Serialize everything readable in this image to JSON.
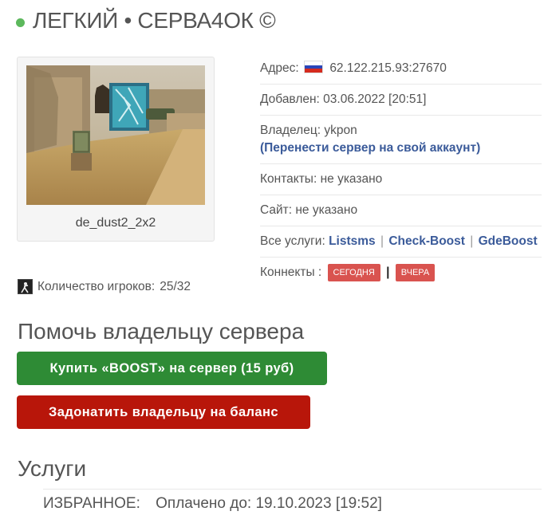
{
  "server": {
    "name": "ЛЕГКИЙ • СЕРВА4ОК ©",
    "map_name": "de_dust2_2x2",
    "players_label": "Количество игроков:",
    "players_value": "25/32"
  },
  "info": {
    "address_label": "Адрес:",
    "address_value": "62.122.215.93:27670",
    "added_label": "Добавлен:",
    "added_value": "03.06.2022 [20:51]",
    "owner_label": "Владелец:",
    "owner_value": "ykpon",
    "transfer_link": "(Перенести сервер на свой аккаунт)",
    "contacts_label": "Контакты:",
    "contacts_value": "не указано",
    "site_label": "Сайт:",
    "site_value": "не указано",
    "services_label": "Все услуги:",
    "services_links": [
      "Listsms",
      "Check-Boost",
      "GdeBoost"
    ],
    "services_sep": "|",
    "connects_label": "Коннекты :",
    "connects_today": "СЕГОДНЯ",
    "connects_sep": "|",
    "connects_yesterday": "ВЧЕРА"
  },
  "help": {
    "title": "Помочь владельцу сервера",
    "boost_button": "Купить «BOOST» на сервер (15 руб)",
    "donate_button": "Задонатить владельцу на баланс"
  },
  "services": {
    "title": "Услуги",
    "item_name": "ИЗБРАННОЕ:",
    "item_status": "Оплачено до: 19.10.2023 [19:52]"
  },
  "colors": {
    "status_online": "#5cb85c",
    "link": "#3b5b9a",
    "badge": "#d9534f",
    "boost_button": "#2e8b35",
    "donate_button": "#b8160a"
  },
  "icons": [
    "status-dot-icon",
    "russia-flag-icon",
    "player-icon"
  ]
}
